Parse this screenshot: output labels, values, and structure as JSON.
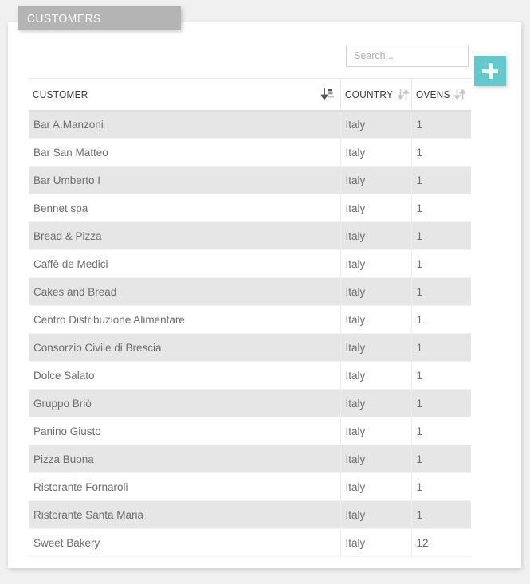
{
  "page": {
    "tab_label": "CUSTOMERS",
    "accent_color": "#62c9cc",
    "tab_color": "#b4b4b4",
    "panel_color": "#ffffff",
    "background_color": "#f0f0f0",
    "stripe_color": "#e6e6e6"
  },
  "search": {
    "placeholder": "Search...",
    "value": ""
  },
  "add_button": {
    "label": "+",
    "icon": "plus-icon"
  },
  "table": {
    "columns": [
      {
        "key": "customer",
        "label": "CUSTOMER",
        "sort_icon": "sort-amount-asc-icon",
        "sort_state": "ascending"
      },
      {
        "key": "country",
        "label": "COUNTRY",
        "sort_icon": "sort-updown-icon",
        "sort_state": "none"
      },
      {
        "key": "ovens",
        "label": "OVENS",
        "sort_icon": "sort-updown-icon",
        "sort_state": "none"
      }
    ],
    "rows": [
      {
        "customer": "Bar A.Manzoni",
        "country": "Italy",
        "ovens": "1"
      },
      {
        "customer": "Bar San Matteo",
        "country": "Italy",
        "ovens": "1"
      },
      {
        "customer": "Bar Umberto I",
        "country": "Italy",
        "ovens": "1"
      },
      {
        "customer": "Bennet spa",
        "country": "Italy",
        "ovens": "1"
      },
      {
        "customer": "Bread & Pizza",
        "country": "Italy",
        "ovens": "1"
      },
      {
        "customer": "Caffè de Medici",
        "country": "Italy",
        "ovens": "1"
      },
      {
        "customer": "Cakes and Bread",
        "country": "Italy",
        "ovens": "1"
      },
      {
        "customer": "Centro Distribuzione Alimentare",
        "country": "Italy",
        "ovens": "1"
      },
      {
        "customer": "Consorzio Civile di Brescia",
        "country": "Italy",
        "ovens": "1"
      },
      {
        "customer": "Dolce Salato",
        "country": "Italy",
        "ovens": "1"
      },
      {
        "customer": "Gruppo Briò",
        "country": "Italy",
        "ovens": "1"
      },
      {
        "customer": "Panino Giusto",
        "country": "Italy",
        "ovens": "1"
      },
      {
        "customer": "Pizza Buona",
        "country": "Italy",
        "ovens": "1"
      },
      {
        "customer": "Ristorante Fornaroli",
        "country": "Italy",
        "ovens": "1"
      },
      {
        "customer": "Ristorante Santa Maria",
        "country": "Italy",
        "ovens": "1"
      },
      {
        "customer": "Sweet Bakery",
        "country": "Italy",
        "ovens": "12"
      }
    ]
  }
}
